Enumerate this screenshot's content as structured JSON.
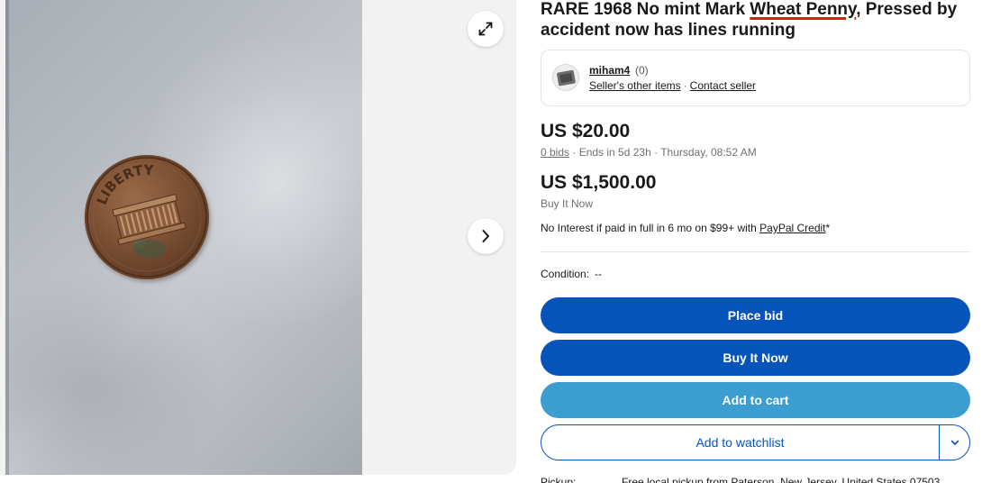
{
  "gallery": {
    "expand_icon": "expand-arrows-icon",
    "next_icon": "chevron-right-icon",
    "coin_text": "LIBERTY"
  },
  "listing": {
    "title_prefix": "RARE 1968 No mint Mark ",
    "title_keyword": "Wheat Penny",
    "title_suffix": ", Pressed by accident now has lines running"
  },
  "seller": {
    "name": "miham4",
    "score": "(0)",
    "other_items_label": "Seller's other items",
    "separator": "·",
    "contact_label": "Contact seller"
  },
  "auction": {
    "price": "US $20.00",
    "bids_label": "0 bids",
    "ends_text": " · Ends in 5d 23h · Thursday, 08:52 AM"
  },
  "buy_now": {
    "price": "US $1,500.00",
    "label": "Buy It Now"
  },
  "credit": {
    "text": "No Interest if paid in full in 6 mo on $99+ with ",
    "link": "PayPal Credit",
    "suffix": "*"
  },
  "condition": {
    "label": "Condition:",
    "value": "--"
  },
  "actions": {
    "place_bid": "Place bid",
    "buy_it_now": "Buy It Now",
    "add_to_cart": "Add to cart",
    "add_to_watchlist": "Add to watchlist"
  },
  "pickup": {
    "label": "Pickup:",
    "value": "Free local pickup from Paterson, New Jersey, United States 07503"
  },
  "colors": {
    "primary_blue": "#0654ba",
    "cart_blue": "#3b9dd0",
    "keyword_underline": "#d91e18"
  }
}
